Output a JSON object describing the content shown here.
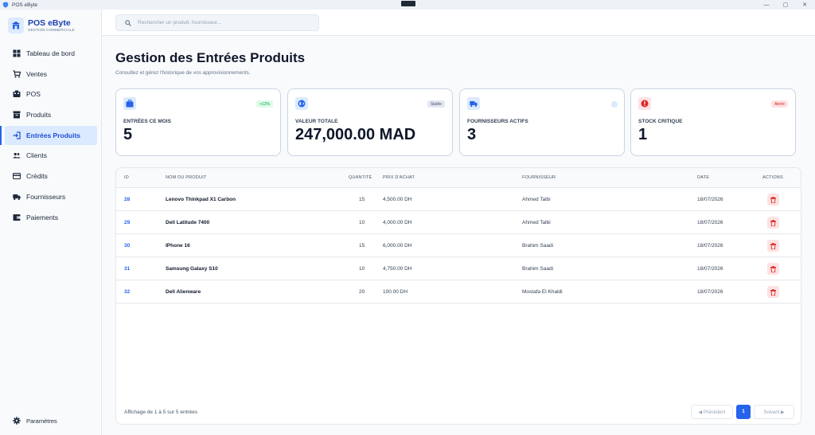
{
  "window": {
    "title": "POS eByte",
    "controls": {
      "minimize": "—",
      "maximize": "▢",
      "close": "✕"
    }
  },
  "brand": {
    "name": "POS eByte",
    "subtitle": "GESTION COMMERCIALE"
  },
  "sidebar": {
    "items": [
      {
        "label": "Tableau de bord",
        "icon": "dashboard-icon"
      },
      {
        "label": "Ventes",
        "icon": "cart-icon"
      },
      {
        "label": "POS",
        "icon": "register-icon"
      },
      {
        "label": "Produits",
        "icon": "archive-icon"
      },
      {
        "label": "Entrées Produits",
        "icon": "login-arrow-icon",
        "active": true
      },
      {
        "label": "Clients",
        "icon": "people-icon"
      },
      {
        "label": "Crédits",
        "icon": "credit-card-icon"
      },
      {
        "label": "Fournisseurs",
        "icon": "truck-icon"
      },
      {
        "label": "Paiements",
        "icon": "wallet-icon"
      }
    ],
    "settings_label": "Paramètres"
  },
  "search": {
    "placeholder": "Rechercher un produit, fournisseur...",
    "value": ""
  },
  "page": {
    "title": "Gestion des Entrées Produits",
    "subtitle": "Consultez et gérez l'historique de vos approvisionnements."
  },
  "stats": [
    {
      "label": "ENTRÉES CE MOIS",
      "value": "5",
      "badge": "+12%",
      "icon": "briefcase-icon"
    },
    {
      "label": "VALEUR TOTALE",
      "value": "247,000.00 MAD",
      "badge": "Stable",
      "icon": "globe-icon"
    },
    {
      "label": "FOURNISSEURS ACTIFS",
      "value": "3",
      "badge": "",
      "icon": "truck-icon"
    },
    {
      "label": "STOCK CRITIQUE",
      "value": "1",
      "badge": "Alerte",
      "icon": "alert-icon"
    }
  ],
  "table": {
    "headers": {
      "id": "ID",
      "name": "NOM DU PRODUIT",
      "qty": "QUANTITÉ",
      "price": "PRIX D'ACHAT",
      "supplier": "FOURNISSEUR",
      "date": "DATE",
      "actions": "ACTIONS"
    },
    "rows": [
      {
        "id": "28",
        "name": "Lenovo Thinkpad X1 Carbon",
        "qty": "15",
        "price": "4,500.00 DH",
        "supplier": "Ahmed Talbi",
        "date": "18/07/2026"
      },
      {
        "id": "29",
        "name": "Dell Latitude 7400",
        "qty": "10",
        "price": "4,000.00 DH",
        "supplier": "Ahmed Talbi",
        "date": "18/07/2026"
      },
      {
        "id": "30",
        "name": "IPhone 16",
        "qty": "15",
        "price": "6,000.00 DH",
        "supplier": "Brahim Saadi",
        "date": "18/07/2026"
      },
      {
        "id": "31",
        "name": "Samsung Galaxy S10",
        "qty": "10",
        "price": "4,750.00 DH",
        "supplier": "Brahim Saadi",
        "date": "18/07/2026"
      },
      {
        "id": "32",
        "name": "Dell Alienware",
        "qty": "20",
        "price": "100.00 DH",
        "supplier": "Mostafa El Khaldi",
        "date": "18/07/2026"
      }
    ],
    "footer": "Affichage de 1 à 5 sur 5 entrées"
  },
  "pagination": {
    "prev": "◀ Précédent",
    "current": "1",
    "next": "Suivant ▶"
  },
  "colors": {
    "accent": "#2563eb",
    "danger": "#dc2626",
    "success": "#16a34a"
  }
}
